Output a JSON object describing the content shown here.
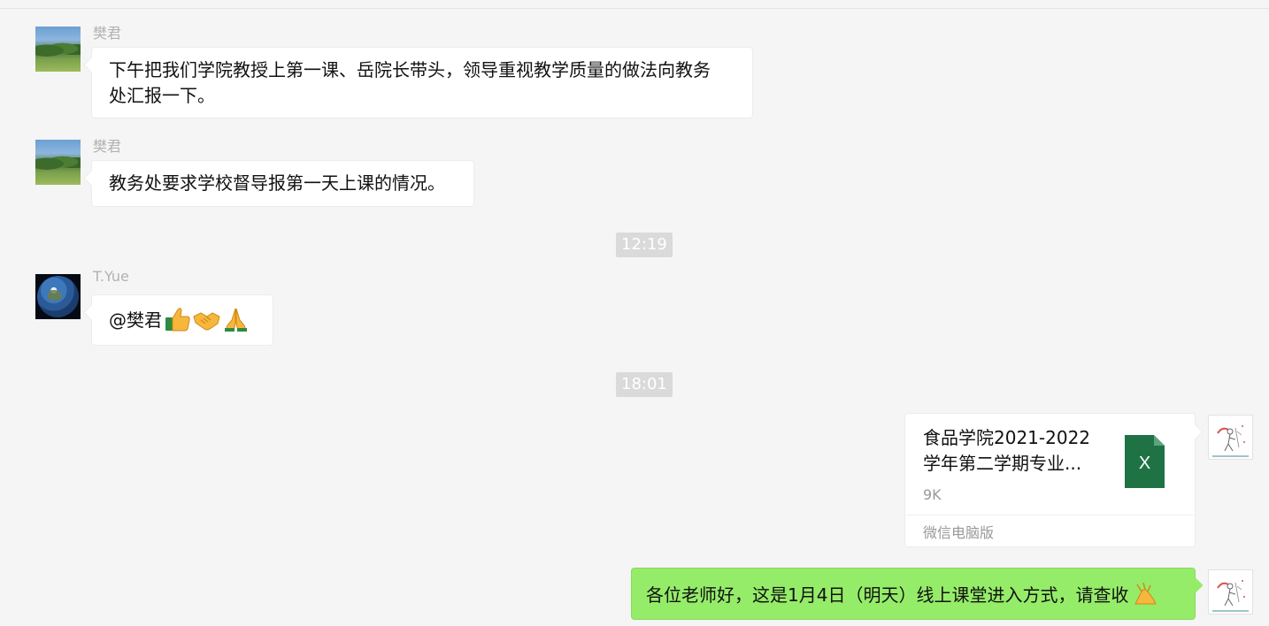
{
  "messages": [
    {
      "sender": "樊君",
      "lines": [
        "下午把我们学院教授上第一课、岳院长带头，领导重视教学质量的做法向教务",
        "处汇报一下。"
      ]
    },
    {
      "sender": "樊君",
      "lines": [
        "教务处要求学校督导报第一天上课的情况。"
      ]
    },
    {
      "timestamp": "12:19"
    },
    {
      "sender": "T.Yue",
      "text": "@樊君",
      "emojis": [
        "thumbs-up",
        "handshake",
        "folded-hands"
      ]
    },
    {
      "timestamp": "18:01"
    },
    {
      "from_self": true,
      "file": {
        "name_lines": [
          "食品学院2021-2022",
          "学年第二学期专业..."
        ],
        "size": "9K",
        "source": "微信电脑版",
        "icon": "excel-file-icon",
        "icon_letter": "X",
        "icon_color": "#1f7244"
      }
    },
    {
      "from_self": true,
      "text": "各位老师好，这是1月4日（明天）线上课堂进入方式，请查收",
      "emoji": "folded-hands"
    }
  ],
  "colors": {
    "background": "#f5f5f5",
    "bubble_white": "#ffffff",
    "bubble_green": "#95ec69",
    "timestamp_bg": "#dadada",
    "name_gray": "#b2b2b2"
  }
}
